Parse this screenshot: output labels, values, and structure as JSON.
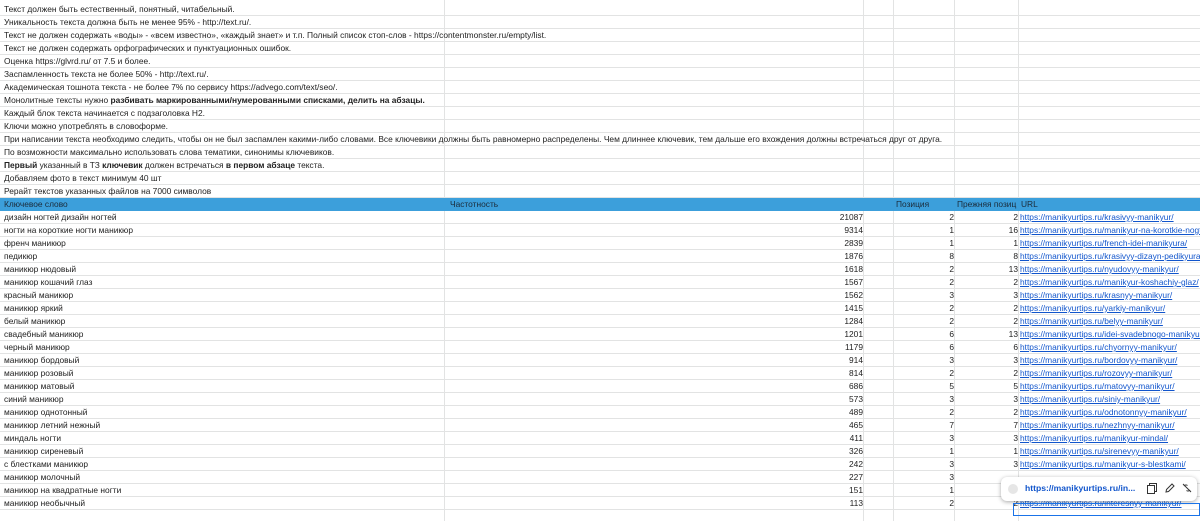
{
  "notes": [
    {
      "text": "Текст должен быть естественный, понятный, читабельный.",
      "link": false
    },
    {
      "text": "Уникальность текста должна быть не менее 95% - http://text.ru/.",
      "link": true
    },
    {
      "text": "Текст не должен содержать «воды» - «всем известно», «каждый знает» и т.п. Полный список стоп-слов - https://contentmonster.ru/empty/list.",
      "link": true
    },
    {
      "text": "Текст не должен содержать орфографических и пунктуационных ошибок.",
      "link": false
    },
    {
      "text": "Оценка https://glvrd.ru/ от 7.5 и более.",
      "link": true
    },
    {
      "text": "Заспамленность текста не более 50%  - http://text.ru/.",
      "link": true
    },
    {
      "text": "Академическая тошнота текста - не более 7% по сервису https://advego.com/text/seo/.",
      "link": true
    },
    {
      "text_parts": [
        {
          "t": "Монолитные тексты нужно ",
          "b": false
        },
        {
          "t": "разбивать маркированными/нумерованными списками, делить на абзацы.",
          "b": true
        }
      ]
    },
    {
      "text": "Каждый блок текста начинается с подзаголовка H2.",
      "link": false
    },
    {
      "text": "Ключи можно употреблять в словоформе.",
      "link": false
    },
    {
      "text": "При написании текста необходимо следить, чтобы он не был заспамлен какими-либо словами. Все ключевики должны быть равномерно распределены. Чем длиннее ключевик, тем дальше его вхождения должны встречаться друг от друга.",
      "link": false
    },
    {
      "text": "По возможности максимально использовать слова тематики, синонимы ключевиков.",
      "link": false
    },
    {
      "text_parts": [
        {
          "t": "Первый",
          "b": true
        },
        {
          "t": " указанный в ТЗ ",
          "b": false
        },
        {
          "t": "ключевик",
          "b": true
        },
        {
          "t": " должен встречаться ",
          "b": false
        },
        {
          "t": "в первом абзаце",
          "b": true
        },
        {
          "t": " текста.",
          "b": false
        }
      ]
    },
    {
      "text": "Добавляем фото в текст минимум 40 шт",
      "link": false
    },
    {
      "text": "Рерайт текстов указанных файлов на 7000 символов",
      "link": false
    }
  ],
  "table": {
    "headers": {
      "keyword": "Ключевое слово",
      "frequency": "Частотность",
      "position": "Позиция",
      "prev_position": "Прежняя позиц",
      "url": "URL"
    },
    "rows": [
      {
        "keyword": "дизайн ногтей дизайн ногтей",
        "frequency": "21087",
        "position": "2",
        "prev": "2",
        "url": "https://manikyurtips.ru/krasivyy-manikyur/"
      },
      {
        "keyword": "ногти на короткие ногти маникюр",
        "frequency": "9314",
        "position": "1",
        "prev": "16",
        "url": "https://manikyurtips.ru/manikyur-na-korotkie-nogti"
      },
      {
        "keyword": "френч маникюр",
        "frequency": "2839",
        "position": "1",
        "prev": "1",
        "url": "https://manikyurtips.ru/french-idei-manikyura/"
      },
      {
        "keyword": "педикюр",
        "frequency": "1876",
        "position": "8",
        "prev": "8",
        "url": "https://manikyurtips.ru/krasivyy-dizayn-pedikyura"
      },
      {
        "keyword": "маникюр нюдовый",
        "frequency": "1618",
        "position": "2",
        "prev": "13",
        "url": "https://manikyurtips.ru/nyudovyy-manikyur/"
      },
      {
        "keyword": "маникюр кошачий глаз",
        "frequency": "1567",
        "position": "2",
        "prev": "2",
        "url": "https://manikyurtips.ru/manikyur-koshachiy-glaz/"
      },
      {
        "keyword": "красный маникюр",
        "frequency": "1562",
        "position": "3",
        "prev": "3",
        "url": "https://manikyurtips.ru/krasnyy-manikyur/"
      },
      {
        "keyword": "маникюр яркий",
        "frequency": "1415",
        "position": "2",
        "prev": "2",
        "url": "https://manikyurtips.ru/yarkiy-manikyur/"
      },
      {
        "keyword": "белый маникюр",
        "frequency": "1284",
        "position": "2",
        "prev": "2",
        "url": "https://manikyurtips.ru/belyy-manikyur/"
      },
      {
        "keyword": "свадебный маникюр",
        "frequency": "1201",
        "position": "6",
        "prev": "13",
        "url": "https://manikyurtips.ru/idei-svadebnogo-manikyura"
      },
      {
        "keyword": "черный маникюр",
        "frequency": "1179",
        "position": "6",
        "prev": "6",
        "url": "https://manikyurtips.ru/chyornyy-manikyur/"
      },
      {
        "keyword": "маникюр бордовый",
        "frequency": "914",
        "position": "3",
        "prev": "3",
        "url": "https://manikyurtips.ru/bordovyy-manikyur/"
      },
      {
        "keyword": "маникюр розовый",
        "frequency": "814",
        "position": "2",
        "prev": "2",
        "url": "https://manikyurtips.ru/rozovyy-manikyur/"
      },
      {
        "keyword": "маникюр матовый",
        "frequency": "686",
        "position": "5",
        "prev": "5",
        "url": "https://manikyurtips.ru/matovyy-manikyur/"
      },
      {
        "keyword": "синий маникюр",
        "frequency": "573",
        "position": "3",
        "prev": "3",
        "url": "https://manikyurtips.ru/siniy-manikyur/"
      },
      {
        "keyword": "маникюр однотонный",
        "frequency": "489",
        "position": "2",
        "prev": "2",
        "url": "https://manikyurtips.ru/odnotonnyy-manikyur/"
      },
      {
        "keyword": "маникюр летний нежный",
        "frequency": "465",
        "position": "7",
        "prev": "7",
        "url": "https://manikyurtips.ru/nezhnyy-manikyur/"
      },
      {
        "keyword": "миндаль ногти",
        "frequency": "411",
        "position": "3",
        "prev": "3",
        "url": "https://manikyurtips.ru/manikyur-mindal/"
      },
      {
        "keyword": "маникюр сиреневый",
        "frequency": "326",
        "position": "1",
        "prev": "1",
        "url": "https://manikyurtips.ru/sirenevyy-manikyur/"
      },
      {
        "keyword": "с блестками маникюр",
        "frequency": "242",
        "position": "3",
        "prev": "3",
        "url": "https://manikyurtips.ru/manikyur-s-blestkami/"
      },
      {
        "keyword": "маникюр молочный",
        "frequency": "227",
        "position": "3",
        "prev": "",
        "url": ""
      },
      {
        "keyword": "маникюр на квадратные ногти",
        "frequency": "151",
        "position": "1",
        "prev": "",
        "url": ""
      },
      {
        "keyword": "маникюр необычный",
        "frequency": "113",
        "position": "2",
        "prev": "2",
        "url": "https://manikyurtips.ru/interesnyy-manikyur/"
      }
    ]
  },
  "tooltip": {
    "url": "https://manikyurtips.ru/in..."
  },
  "colors": {
    "header_bg": "#3c9fdb",
    "link": "#1155cc",
    "grid": "#e2e3e3"
  }
}
